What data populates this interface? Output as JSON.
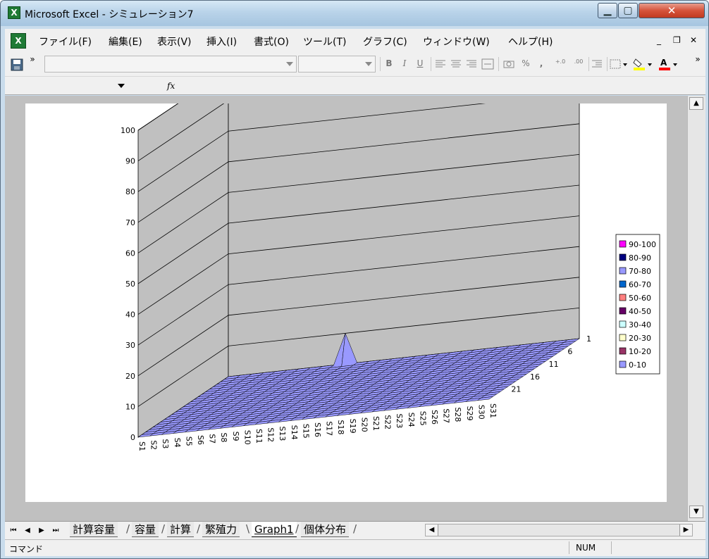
{
  "window": {
    "title": "Microsoft Excel - シミュレーション7",
    "app_icon": "X"
  },
  "window_controls": {
    "minimize": "▁",
    "maximize": "▢",
    "close": "✕"
  },
  "menu": {
    "doc_icon": "X",
    "items": [
      "ファイル(F)",
      "編集(E)",
      "表示(V)",
      "挿入(I)",
      "書式(O)",
      "ツール(T)",
      "グラフ(C)",
      "ウィンドウ(W)",
      "ヘルプ(H)"
    ],
    "mdi_minimize": "_",
    "mdi_restore": "❐",
    "mdi_close": "✕"
  },
  "toolbar": {
    "bold": "B",
    "italic": "I",
    "underline": "U",
    "percent": "%",
    "comma": ",",
    "inc_decimal": "+.0",
    "dec_decimal": ".00",
    "overflow": "»"
  },
  "formula_bar": {
    "fx": "fx"
  },
  "chart_data": {
    "type": "surface-3d",
    "z_axis": {
      "ticks": [
        "0",
        "10",
        "20",
        "30",
        "40",
        "50",
        "60",
        "70",
        "80",
        "90",
        "100"
      ],
      "min": 0,
      "max": 100
    },
    "x_categories": [
      "S1",
      "S2",
      "S3",
      "S4",
      "S5",
      "S6",
      "S7",
      "S8",
      "S9",
      "S10",
      "S11",
      "S12",
      "S13",
      "S14",
      "S15",
      "S16",
      "S17",
      "S18",
      "S19",
      "S20",
      "S21",
      "S22",
      "S23",
      "S24",
      "S25",
      "S26",
      "S27",
      "S28",
      "S29",
      "S30",
      "S31"
    ],
    "y_depth_ticks": [
      "1",
      "6",
      "11",
      "16",
      "21"
    ],
    "series_depth": 25,
    "peak": {
      "x": "S11",
      "depth": 24,
      "value": 10
    },
    "base_value": 0,
    "legend": [
      {
        "label": "90-100",
        "color": "#ff00ff"
      },
      {
        "label": "80-90",
        "color": "#000080"
      },
      {
        "label": "70-80",
        "color": "#9999ff"
      },
      {
        "label": "60-70",
        "color": "#0066cc"
      },
      {
        "label": "50-60",
        "color": "#ff8080"
      },
      {
        "label": "40-50",
        "color": "#660066"
      },
      {
        "label": "30-40",
        "color": "#ccffff"
      },
      {
        "label": "20-30",
        "color": "#ffffcc"
      },
      {
        "label": "10-20",
        "color": "#993366"
      },
      {
        "label": "0-10",
        "color": "#9999ff"
      }
    ],
    "legend_position": "right",
    "grid": true,
    "walls_color": "#c0c0c0"
  },
  "sheet_tabs": {
    "nav": [
      "⏮",
      "◀",
      "▶",
      "⏭"
    ],
    "tabs": [
      "計算容量",
      "容量",
      "計算",
      "繁殖力",
      "Graph1",
      "個体分布"
    ],
    "active": "Graph1"
  },
  "scrollbars": {
    "up": "▲",
    "down": "▼",
    "left": "◀",
    "right": "▶"
  },
  "status": {
    "mode": "コマンド",
    "num": "NUM"
  }
}
